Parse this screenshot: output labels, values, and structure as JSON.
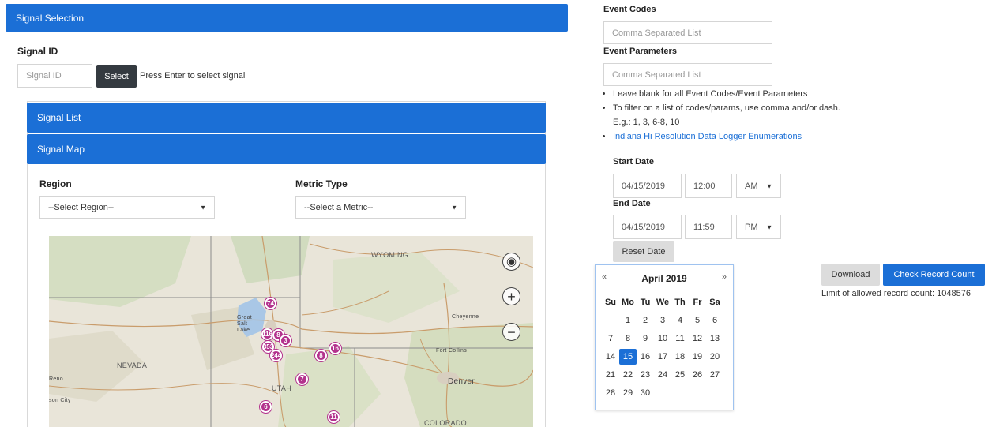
{
  "signal_selection": {
    "title": "Signal Selection"
  },
  "signal_id": {
    "label": "Signal ID",
    "placeholder": "Signal ID",
    "select_button": "Select",
    "hint": "Press Enter to select signal"
  },
  "signal_list": {
    "title": "Signal List"
  },
  "signal_map": {
    "title": "Signal Map",
    "region_label": "Region",
    "region_value": "--Select Region--",
    "metric_label": "Metric Type",
    "metric_value": "--Select a Metric--"
  },
  "map": {
    "labels": {
      "wyoming": "WYOMING",
      "nevada": "NEVADA",
      "utah": "UTAH",
      "colorado": "COLORADO",
      "denver": "Denver",
      "cheyenne": "Cheyenne",
      "fort_collins": "Fort Collins",
      "great_salt_lake": "Great Salt Lake",
      "reno": "Reno",
      "carson_city": "son City"
    },
    "markers": [
      "74",
      "116",
      "8",
      "3",
      "353",
      "244",
      "8",
      "16",
      "7",
      "6",
      "11"
    ],
    "controls": {
      "locate": "◉",
      "zoom_in": "+",
      "zoom_out": "−"
    },
    "colors": {
      "marker": "#b3328d",
      "land": "#e8e4d8",
      "water": "#aac8e6"
    }
  },
  "event_codes": {
    "label": "Event Codes",
    "placeholder": "Comma Separated List"
  },
  "event_parameters": {
    "label": "Event Parameters",
    "placeholder": "Comma Separated List"
  },
  "notes": {
    "item1": "Leave blank for all Event Codes/Event Parameters",
    "item2": "To filter on a list of codes/params, use comma and/or dash. E.g.: 1, 3, 6-8, 10",
    "link": "Indiana Hi Resolution Data Logger Enumerations"
  },
  "start_date": {
    "label": "Start Date",
    "date": "04/15/2019",
    "time": "12:00",
    "ampm": "AM"
  },
  "end_date": {
    "label": "End Date",
    "date": "04/15/2019",
    "time": "11:59",
    "ampm": "PM"
  },
  "reset_date": "Reset Date",
  "download": "Download",
  "check_record_count": "Check Record Count",
  "limit_text": "Limit of allowed record count: 1048576",
  "calendar": {
    "prev": "«",
    "next": "»",
    "month": "April 2019",
    "dows": [
      "Su",
      "Mo",
      "Tu",
      "We",
      "Th",
      "Fr",
      "Sa"
    ],
    "weeks": [
      [
        "",
        "1",
        "2",
        "3",
        "4",
        "5",
        "6"
      ],
      [
        "7",
        "8",
        "9",
        "10",
        "11",
        "12",
        "13"
      ],
      [
        "14",
        "15",
        "16",
        "17",
        "18",
        "19",
        "20"
      ],
      [
        "21",
        "22",
        "23",
        "24",
        "25",
        "26",
        "27"
      ],
      [
        "28",
        "29",
        "30",
        "",
        "",
        "",
        ""
      ]
    ],
    "selected": "15"
  },
  "colors": {
    "accent": "#1b6fd6",
    "dark_button": "#343a40",
    "grey_button": "#dcdcdc"
  }
}
